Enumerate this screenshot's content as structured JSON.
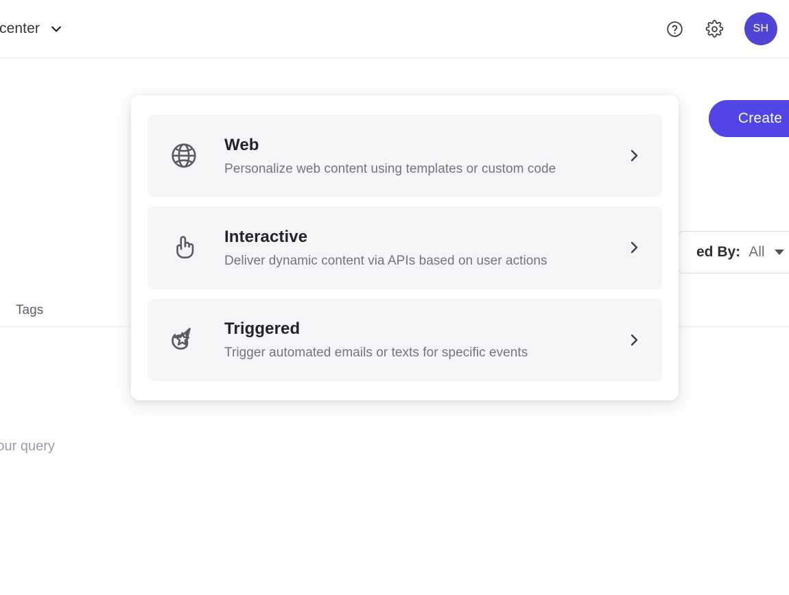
{
  "topbar": {
    "workspace_label": "r center",
    "workspace_chevron_icon": "chevron-down-icon",
    "help_icon": "help-circle-icon",
    "settings_icon": "gear-icon",
    "avatar_initials": "SH",
    "avatar_color": "#5145d8"
  },
  "page": {
    "create_button_label": "Create",
    "create_button_color": "#5145e5",
    "filter": {
      "label": "ed By:",
      "value": "All",
      "caret_icon": "caret-down-icon"
    },
    "table": {
      "columns": [
        "Tags"
      ]
    },
    "empty_message": "hing your query"
  },
  "modal": {
    "options": [
      {
        "icon": "globe-icon",
        "title": "Web",
        "description": "Personalize web content using templates or custom code",
        "chevron_icon": "chevron-right-icon"
      },
      {
        "icon": "pointing-hand-icon",
        "title": "Interactive",
        "description": "Deliver dynamic content via APIs based on user actions",
        "chevron_icon": "chevron-right-icon"
      },
      {
        "icon": "shooting-star-icon",
        "title": "Triggered",
        "description": "Trigger automated emails or texts for specific events",
        "chevron_icon": "chevron-right-icon"
      }
    ]
  }
}
